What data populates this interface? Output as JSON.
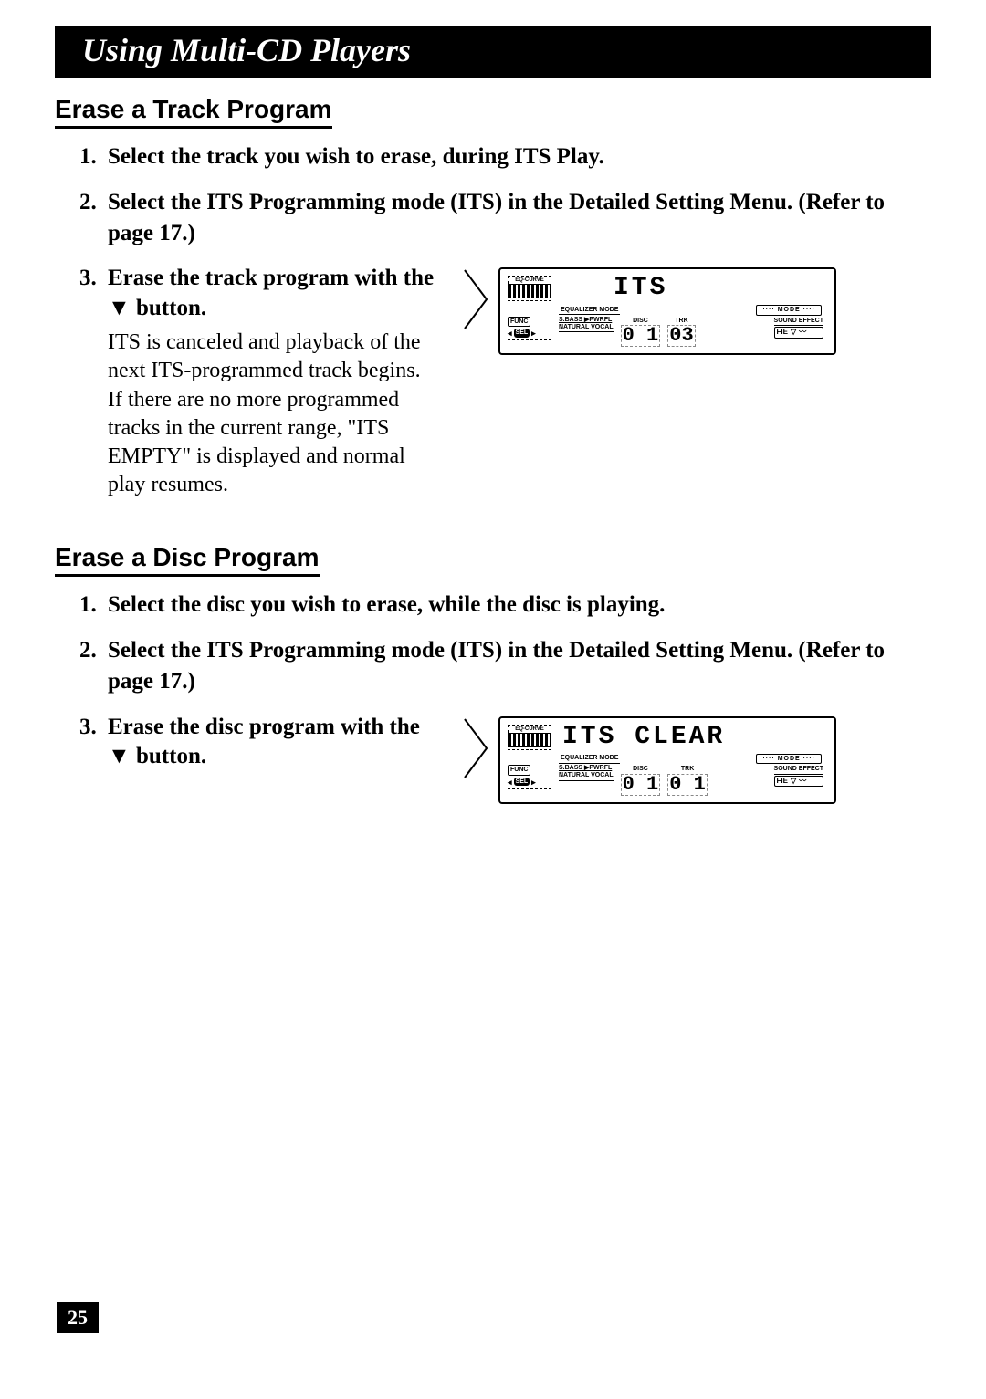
{
  "title": "Using Multi-CD Players",
  "page_number": "25",
  "section1": {
    "heading": "Erase a Track Program",
    "step1": "Select the track you wish to erase, during ITS Play.",
    "step2": "Select the ITS Programming mode (ITS) in the Detailed Setting Menu. (Refer to page 17.)",
    "step3": "Erase the track program with the ▼ button.",
    "step3_explain": "ITS is canceled and playback of the next ITS-programmed track begins. If there are no more programmed tracks in the current range, \"ITS EMPTY\" is displayed and normal play resumes."
  },
  "section2": {
    "heading": "Erase a Disc Program",
    "step1": "Select the disc you wish to erase, while the disc is playing.",
    "step2": "Select the ITS Programming mode (ITS) in the Detailed Setting Menu. (Refer to page 17.)",
    "step3": "Erase the disc program with the ▼ button."
  },
  "display1": {
    "big_text": "ITS",
    "eq_label": "EQ-CURVE",
    "eq_mode": "EQUALIZER MODE",
    "mode": "···· MODE ····",
    "func": "FUNC",
    "sel": "SEL",
    "sbass": "S.BASS ▶PWRFL",
    "natural": "NATURAL  VOCAL",
    "disc_label": "DISC",
    "trk_label": "TRK",
    "disc": "0 1",
    "trk": "03",
    "sound": "SOUND EFFECT",
    "fie": "FIE"
  },
  "display2": {
    "big_text": "ITS CLEAR",
    "eq_label": "EQ-CURVE",
    "eq_mode": "EQUALIZER MODE",
    "mode": "···· MODE ····",
    "func": "FUNC",
    "sel": "SEL",
    "sbass": "S.BASS ▶PWRFL",
    "natural": "NATURAL  VOCAL",
    "disc_label": "DISC",
    "trk_label": "TRK",
    "disc": "0 1",
    "trk": "0 1",
    "sound": "SOUND EFFECT",
    "fie": "FIE"
  }
}
